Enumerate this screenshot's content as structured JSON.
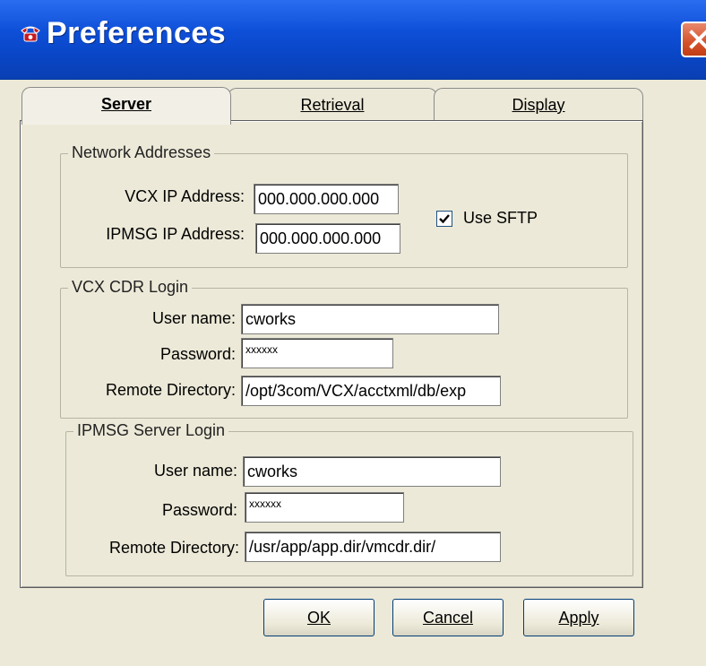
{
  "window": {
    "title": "Preferences",
    "close_label": "✕"
  },
  "tabs": [
    {
      "label": "Server",
      "active": true
    },
    {
      "label": "Retrieval",
      "active": false
    },
    {
      "label": "Display",
      "active": false
    }
  ],
  "network": {
    "legend": "Network Addresses",
    "vcx_ip_label": "VCX IP Address:",
    "vcx_ip_value": "000.000.000.000",
    "ipmsg_ip_label": "IPMSG IP Address:",
    "ipmsg_ip_value": "000.000.000.000",
    "use_sftp_label": "Use SFTP",
    "use_sftp_checked": true
  },
  "vcx_login": {
    "legend": "VCX CDR Login",
    "user_label": "User name:",
    "user_value": "cworks",
    "password_label": "Password:",
    "password_value": "xxxxxx",
    "remote_dir_label": "Remote Directory:",
    "remote_dir_value": "/opt/3com/VCX/acctxml/db/exp"
  },
  "ipmsg_login": {
    "legend": "IPMSG Server Login",
    "user_label": "User name:",
    "user_value": "cworks",
    "password_label": "Password:",
    "password_value": "xxxxxx",
    "remote_dir_label": "Remote Directory:",
    "remote_dir_value": "/usr/app/app.dir/vmcdr.dir/"
  },
  "buttons": {
    "ok": "OK",
    "cancel": "Cancel",
    "apply": "Apply"
  },
  "colors": {
    "titlebar": "#0946c6",
    "close": "#d4512a",
    "face": "#ece9d8"
  }
}
